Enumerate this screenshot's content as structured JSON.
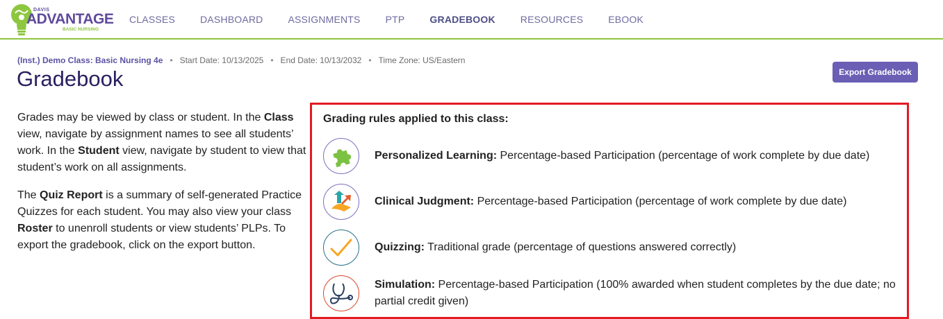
{
  "brand": {
    "small": "DAVIS",
    "name": "ADVANTAGE",
    "sub": "BASIC NURSING"
  },
  "nav": [
    {
      "label": "CLASSES",
      "active": false
    },
    {
      "label": "DASHBOARD",
      "active": false
    },
    {
      "label": "ASSIGNMENTS",
      "active": false
    },
    {
      "label": "PTP",
      "active": false
    },
    {
      "label": "GRADEBOOK",
      "active": true
    },
    {
      "label": "RESOURCES",
      "active": false
    },
    {
      "label": "EBOOK",
      "active": false
    }
  ],
  "meta": {
    "class_name": "(Inst.) Demo Class: Basic Nursing 4e",
    "start_date": "Start Date: 10/13/2025",
    "end_date": "End Date: 10/13/2032",
    "time_zone": "Time Zone: US/Eastern"
  },
  "page_title": "Gradebook",
  "export_button": "Export Gradebook",
  "intro": {
    "p1_a": "Grades may be viewed by class or student. In the ",
    "p1_b": "Class",
    "p1_c": " view, navigate by assignment names to see all students’ work. In the ",
    "p1_d": "Student",
    "p1_e": " view, navigate by student to view that student’s work on all assignments.",
    "p2_a": "The ",
    "p2_b": "Quiz Report",
    "p2_c": " is a summary of self-generated Practice Quizzes for each student. You may also view your class ",
    "p2_d": "Roster",
    "p2_e": " to unenroll students or view students’ PLPs. To export the gradebook, click on the export button."
  },
  "rules": {
    "title": "Grading rules applied to this class:",
    "items": [
      {
        "name": "Personalized Learning:",
        "desc": " Percentage-based Participation (percentage of work complete by due date)",
        "icon": "puzzle-icon"
      },
      {
        "name": "Clinical Judgment:",
        "desc": " Percentage-based Participation (percentage of work complete by due date)",
        "icon": "arrows-icon"
      },
      {
        "name": "Quizzing:",
        "desc": " Traditional grade (percentage of questions answered correctly)",
        "icon": "checkmark-icon"
      },
      {
        "name": "Simulation:",
        "desc": " Percentage-based Participation (100% awarded when student completes by the due date; no partial credit given)",
        "icon": "stethoscope-icon"
      }
    ]
  },
  "colors": {
    "brand_purple": "#5e4a9c",
    "brand_green": "#8dc63f",
    "highlight_red": "#e21a22",
    "button_purple": "#6a5fb4"
  }
}
